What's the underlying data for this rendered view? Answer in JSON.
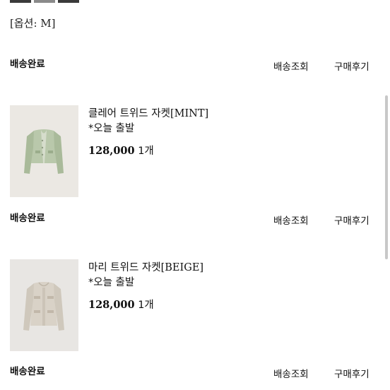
{
  "option_label": "[옵션: M]",
  "status_top": "배송완료",
  "actions": {
    "shipping": "배송조회",
    "review": "구매후기"
  },
  "orders": [
    {
      "name": "클레어 트위드 자켓",
      "variant": "[MINT]",
      "note": "*오늘 출발",
      "price": "128,000",
      "qty": "1개",
      "status": "배송완료"
    },
    {
      "name": "마리 트위드 자켓",
      "variant": "[BEIGE]",
      "note": "*오늘 출발",
      "price": "128,000",
      "qty": "1개",
      "status": "배송완료"
    }
  ]
}
